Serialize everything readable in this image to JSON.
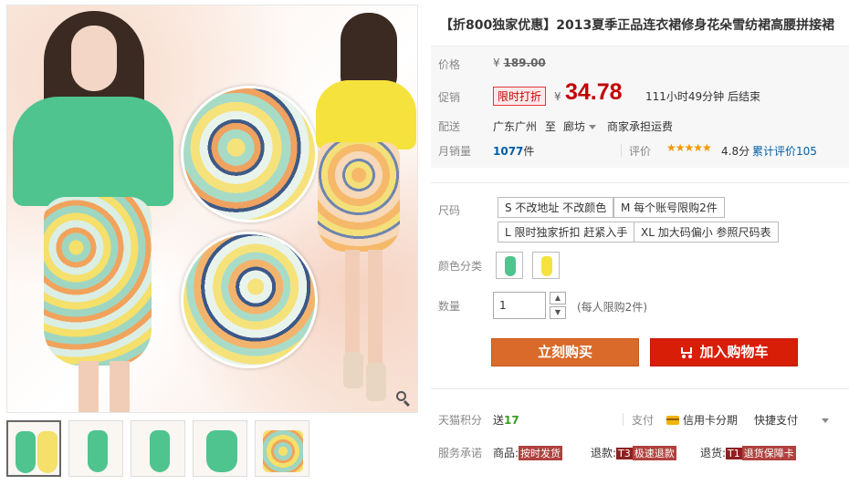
{
  "product": {
    "title": "【折800独家优惠】2013夏季正品连衣裙修身花朵雪纺裙高腰拼接裙"
  },
  "price": {
    "label": "价格",
    "currency": "¥",
    "original": "189.00"
  },
  "promo": {
    "label": "促销",
    "tag": "限时打折",
    "currency": "¥",
    "price": "34.78",
    "countdown": "111小时49分钟 后结束"
  },
  "shipping": {
    "label": "配送",
    "from": "广东广州",
    "to_word": "至",
    "to": "廊坊",
    "fee": "商家承担运费"
  },
  "sales": {
    "label": "月销量",
    "count": "1077",
    "unit": "件",
    "rating_label": "评价",
    "stars": "★★★★★",
    "score": "4.8分",
    "reviews": "累计评价105"
  },
  "size": {
    "label": "尺码",
    "options": [
      "S 不改地址 不改颜色",
      "M 每个账号限购2件",
      "L 限时独家折扣 赶紧入手",
      "XL 加大码偏小 参照尺码表"
    ]
  },
  "color": {
    "label": "颜色分类",
    "swatches": [
      "#4fc48e",
      "#f6e23c"
    ]
  },
  "quantity": {
    "label": "数量",
    "value": "1",
    "limit_note": "(每人限购2件)"
  },
  "buttons": {
    "buy": "立刻购买",
    "cart": "加入购物车"
  },
  "points": {
    "label": "天猫积分",
    "prefix": "送",
    "value": "17"
  },
  "payment": {
    "label": "支付",
    "credit": "信用卡分期",
    "quick": "快捷支付"
  },
  "service": {
    "label": "服务承诺",
    "goods_label": "商品:",
    "goods_badge": "按时发货",
    "refund_label": "退款:",
    "refund_code": "T3",
    "refund_badge": "极速退款",
    "return_label": "退货:",
    "return_code": "T1",
    "return_badge": "退货保障卡"
  },
  "gallery": {
    "thumb_colors": [
      "#4fc48e",
      "#4fc48e",
      "#4fc48e",
      "#4fc48e",
      "#f4e06a"
    ]
  },
  "colors": {
    "accent_red": "#c40000",
    "buy_orange": "#d96a2a",
    "cart_red": "#d81e06",
    "link_blue": "#005ea7"
  }
}
